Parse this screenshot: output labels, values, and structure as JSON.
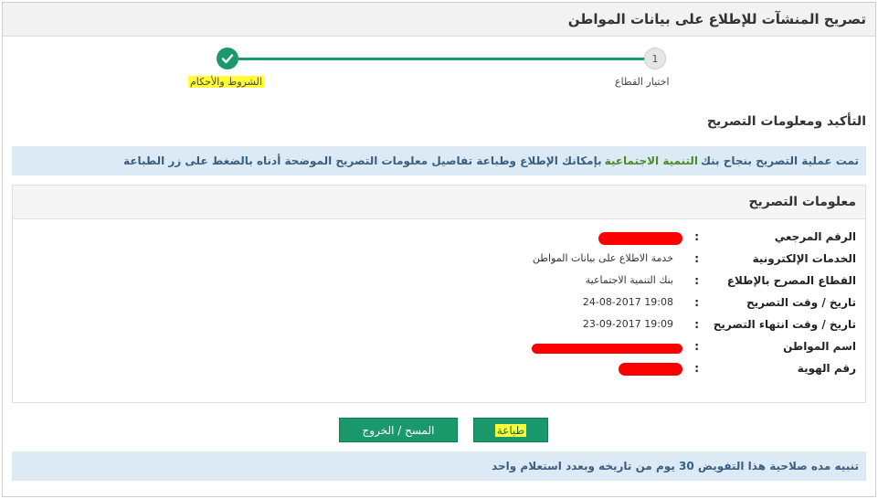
{
  "header": {
    "title": "تصريح المنشآت للإطلاع على بيانات المواطن"
  },
  "stepper": {
    "steps": [
      {
        "number": "1",
        "label": "اختيار القطاع"
      },
      {
        "label": "الشروط والأحكام"
      }
    ],
    "active_color": "#1a9a6c"
  },
  "section": {
    "title": "التأكيد ومعلومات التصريح"
  },
  "success": {
    "part1": "تمت عملية التصريح بنجاح بنك",
    "highlight": "التنمية الاجتماعية",
    "part2": "بإمكانك الإطلاع وطباعة تفاصيل معلومات التصريح الموضحة أدناه بالضغط على زر الطباعة"
  },
  "panel": {
    "title": "معلومات التصريح",
    "rows": [
      {
        "label": "الرقم المرجعي",
        "colon": ":",
        "value": ""
      },
      {
        "label": "الخدمات الإلكترونية",
        "colon": ":",
        "value": "خدمة الاطلاع على بيانات المواطن"
      },
      {
        "label": "القطاع المصرح بالإطلاع",
        "colon": ":",
        "value": "بنك التنمية الاجتماعية"
      },
      {
        "label": "تاريخ / وقت التصريح",
        "colon": ":",
        "value": "19:08 24-08-2017"
      },
      {
        "label": "تاريخ / وقت انتهاء التصريح",
        "colon": ":",
        "value": "19:09 23-09-2017"
      },
      {
        "label": "اسم المواطن",
        "colon": ":",
        "value": ""
      },
      {
        "label": "رقم الهوية",
        "colon": ":",
        "value": ""
      }
    ]
  },
  "buttons": {
    "print": "طباعة",
    "clear_exit": "المسح / الخروج"
  },
  "note": {
    "text": "تنبيه مده صلاحية هذا التفويض 30 يوم من تاريخه وبعدد استعلام واحد"
  }
}
